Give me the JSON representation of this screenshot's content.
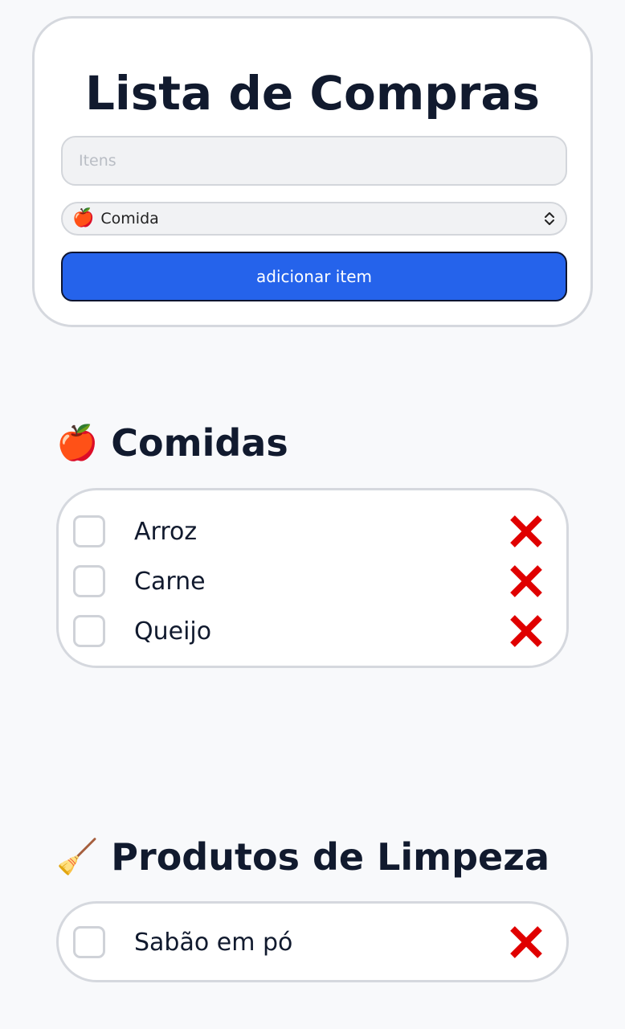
{
  "header": {
    "title": "Lista de Compras"
  },
  "form": {
    "item_placeholder": "Itens",
    "item_value": "",
    "category_emoji": "🍎",
    "category_selected": "Comida",
    "add_button_label": "adicionar item"
  },
  "sections": [
    {
      "emoji": "🍎",
      "title": "Comidas",
      "items": [
        {
          "label": "Arroz",
          "checked": false
        },
        {
          "label": "Carne",
          "checked": false
        },
        {
          "label": "Queijo",
          "checked": false
        }
      ]
    },
    {
      "emoji": "🧹",
      "title": "Produtos de Limpeza",
      "items": [
        {
          "label": "Sabão em pó",
          "checked": false
        }
      ]
    }
  ],
  "colors": {
    "accent": "#2563eb",
    "delete": "#e00000",
    "text": "#111a2e",
    "border": "#d5d8de",
    "background": "#f8f9fb"
  },
  "icons": {
    "delete": "close-icon",
    "select_arrows": "chevron-up-down-icon"
  }
}
